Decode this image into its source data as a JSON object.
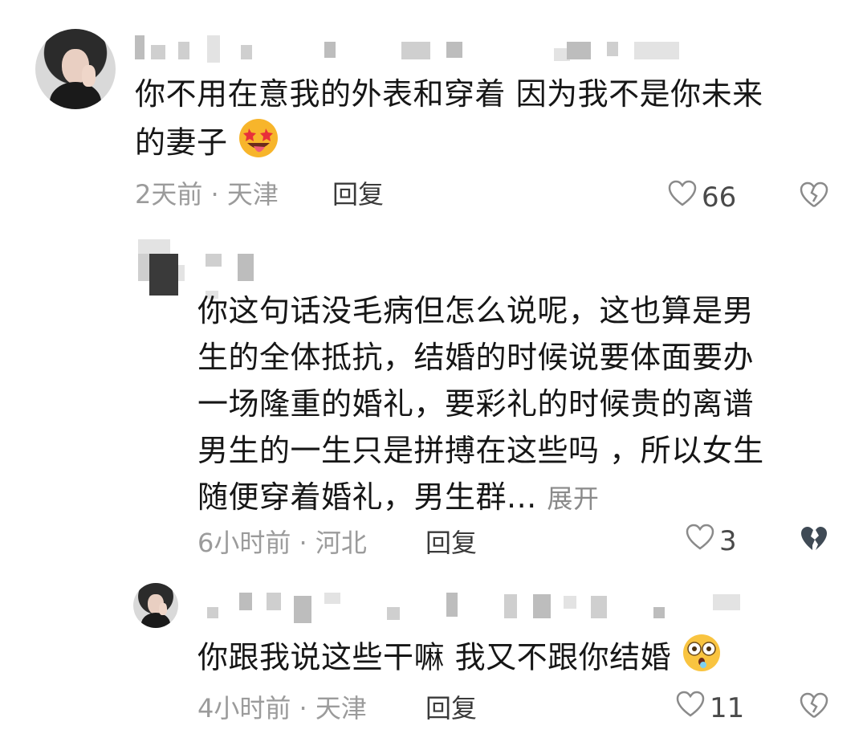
{
  "comments": [
    {
      "text_line1": "你不用在意我的外表和穿着 因为我不是你未来",
      "text_line2": "的妻子",
      "emoji": "star-struck-tongue-emoji",
      "time_location": "2天前 · 天津",
      "reply_label": "回复",
      "likes": "66"
    },
    {
      "lines": [
        "你这句话没毛病但怎么说呢，这也算是男",
        "生的全体抵抗，结婚的时候说要体面要办",
        "一场隆重的婚礼，要彩礼的时候贵的离谱",
        "男生的一生只是拼搏在这些吗 ，所以女生"
      ],
      "last_line": "随便穿着婚礼，男生群...",
      "expand_label": "展开",
      "time_location": "6小时前 · 河北",
      "reply_label": "回复",
      "likes": "3"
    },
    {
      "text": "你跟我说这些干嘛 我又不跟你结婚",
      "emoji": "flushed-face-emoji",
      "time_location": "4小时前 · 天津",
      "reply_label": "回复",
      "likes": "11"
    }
  ],
  "colors": {
    "text": "#161616",
    "meta": "#9b9b9b",
    "pixelate": "#cfcfcf"
  }
}
